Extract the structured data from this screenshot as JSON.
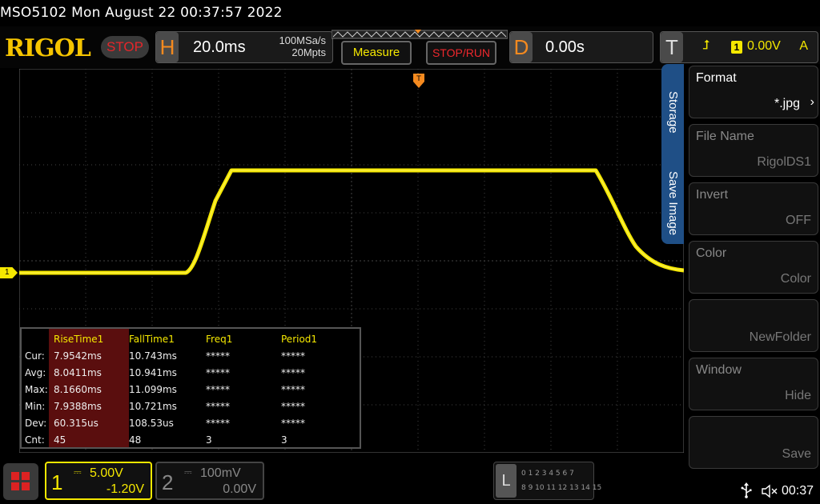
{
  "titlebar": {
    "text": "MSO5102  Mon August 22 00:37:57 2022"
  },
  "brand": {
    "logo": "RIGOL",
    "run_state": "STOP"
  },
  "horizontal": {
    "key": "H",
    "timebase": "20.0ms",
    "sample_rate": "100MSa/s",
    "memory_depth": "20Mpts"
  },
  "buttons": {
    "measure": "Measure",
    "stop_run": "STOP/RUN"
  },
  "delay": {
    "key": "D",
    "value": "0.00s"
  },
  "trigger": {
    "key": "T",
    "edge_symbol": "⮥",
    "source": "1",
    "level": "0.00V",
    "mode": "A"
  },
  "channel_marker": {
    "label": "1"
  },
  "measurements": {
    "headers": [
      "RiseTime1",
      "FallTime1",
      "Freq1",
      "Period1"
    ],
    "rows": [
      {
        "label": "Cur:",
        "values": [
          "7.9542ms",
          "10.743ms",
          "*****",
          "*****"
        ]
      },
      {
        "label": "Avg:",
        "values": [
          "8.0411ms",
          "10.941ms",
          "*****",
          "*****"
        ]
      },
      {
        "label": "Max:",
        "values": [
          "8.1660ms",
          "11.099ms",
          "*****",
          "*****"
        ]
      },
      {
        "label": "Min:",
        "values": [
          "7.9388ms",
          "10.721ms",
          "*****",
          "*****"
        ]
      },
      {
        "label": "Dev:",
        "values": [
          "60.315us",
          "108.53us",
          "*****",
          "*****"
        ]
      },
      {
        "label": "Cnt:",
        "values": [
          "45",
          "48",
          "3",
          "3"
        ]
      }
    ]
  },
  "side_tabs": {
    "storage": "Storage",
    "save_image": "Save Image"
  },
  "side_menu": [
    {
      "title": "Format",
      "value": "*.jpg"
    },
    {
      "title": "File Name",
      "value": "RigolDS1"
    },
    {
      "title": "Invert",
      "value": "OFF"
    },
    {
      "title": "Color",
      "value": "Color"
    },
    {
      "title": "",
      "value": "NewFolder"
    },
    {
      "title": "Window",
      "value": "Hide"
    },
    {
      "title": "",
      "value": "Save"
    }
  ],
  "ch1": {
    "num": "1",
    "coupling": "⎓",
    "scale": "5.00V",
    "offset": "-1.20V"
  },
  "ch2": {
    "num": "2",
    "coupling": "⎓",
    "scale": "100mV",
    "offset": "0.00V"
  },
  "logic": {
    "key": "L",
    "row1": "0 1 2 3   4 5 6 7",
    "row2": "8 9 10 11 12 13 14 15"
  },
  "status": {
    "time": "00:37"
  },
  "colors": {
    "ch1": "#f5e800",
    "ch1_bg": "#5a0e0e",
    "accent": "#1f4f86",
    "stop": "#e6262a",
    "orange": "#f58a1f"
  }
}
